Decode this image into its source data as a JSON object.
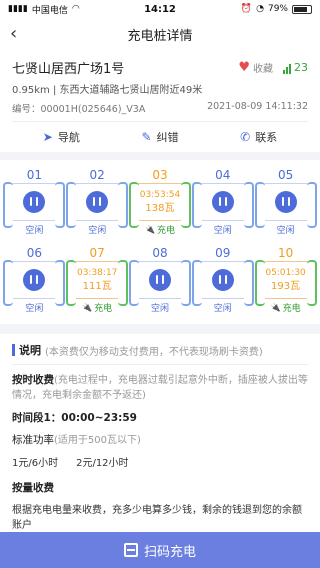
{
  "status_bar": {
    "carrier": "中国电信",
    "time": "14:12",
    "battery": "79%",
    "battery_level": 0.79
  },
  "nav": {
    "title": "充电桩详情"
  },
  "station": {
    "name": "七贤山居西广场1号",
    "fav_label": "收藏",
    "signal_label": "23",
    "address": "0.95km | 东西大道辅路七贤山居附近49米",
    "code": "编号：00001H(025646)_V3A",
    "datetime": "2021-08-09 14:11:32"
  },
  "actions": [
    {
      "icon": "navigation-icon",
      "label": "导航"
    },
    {
      "icon": "edit-icon",
      "label": "纠错"
    },
    {
      "icon": "phone-icon",
      "label": "联系"
    }
  ],
  "plugs": [
    {
      "num": "01",
      "state": "idle",
      "label": "空闲"
    },
    {
      "num": "02",
      "state": "idle",
      "label": "空闲"
    },
    {
      "num": "03",
      "state": "charging",
      "label": "充电",
      "time": "03:53:54",
      "power": "138瓦"
    },
    {
      "num": "04",
      "state": "idle",
      "label": "空闲"
    },
    {
      "num": "05",
      "state": "idle",
      "label": "空闲"
    },
    {
      "num": "06",
      "state": "idle",
      "label": "空闲"
    },
    {
      "num": "07",
      "state": "charging",
      "label": "充电",
      "time": "03:38:17",
      "power": "111瓦"
    },
    {
      "num": "08",
      "state": "idle",
      "label": "空闲"
    },
    {
      "num": "09",
      "state": "idle",
      "label": "空闲"
    },
    {
      "num": "10",
      "state": "charging",
      "label": "充电",
      "time": "05:01:30",
      "power": "193瓦"
    }
  ],
  "explain": {
    "title": "说明",
    "note": "(本资费仅为移动支付费用，不代表现场刷卡资费)",
    "time_fee_title": "按时收费",
    "time_fee_note": "(充电过程中，充电器过载引起意外中断，插座被人拔出等情况，充电剩余金额不予返还)",
    "period_label": "时间段1：00:00~23:59",
    "std_power_label": "标准功率",
    "std_power_note": "(适用于500瓦以下)",
    "price_1": "1元/6小时",
    "price_2": "2元/12小时",
    "qty_fee_title": "按量收费",
    "qty_fee_text": "根据充电电量来收费，充多少电算多少钱，剩余的钱退到您的余额账户"
  },
  "bottom": {
    "scan_label": "扫码充电"
  },
  "colors": {
    "accent": "#4d6cd9",
    "busy": "#f39c1e",
    "charging": "#2f9a2f",
    "button": "#6b7fe0"
  }
}
